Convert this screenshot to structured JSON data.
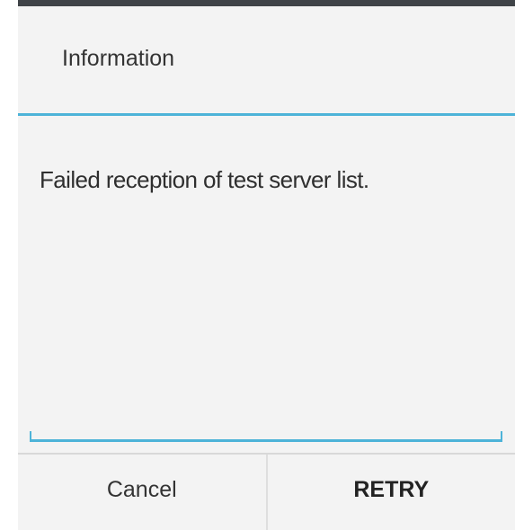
{
  "dialog": {
    "title": "Information",
    "message": "Failed reception of test server list.",
    "buttons": {
      "cancel_label": "Cancel",
      "retry_label": "RETRY"
    }
  },
  "colors": {
    "accent": "#4db3d8",
    "background": "#f3f3f3",
    "top_border": "#3f4347"
  }
}
